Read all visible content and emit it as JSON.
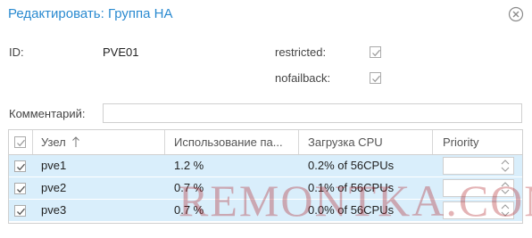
{
  "dialog": {
    "title": "Редактировать: Группа HA",
    "close_icon": "close-circle-icon"
  },
  "form": {
    "id_label": "ID:",
    "id_value": "PVE01",
    "restricted_label": "restricted:",
    "restricted_checked": false,
    "nofailback_label": "nofailback:",
    "nofailback_checked": false,
    "comment_label": "Комментарий:",
    "comment_value": "",
    "comment_placeholder": ""
  },
  "grid": {
    "columns": {
      "node": "Узел",
      "sort_icon": "arrow-up-icon",
      "usage": "Использование па...",
      "cpu": "Загрузка CPU",
      "priority": "Priority"
    },
    "rows": [
      {
        "checked": true,
        "node": "pve1",
        "usage": "1.2 %",
        "cpu": "0.2% of 56CPUs",
        "priority": ""
      },
      {
        "checked": true,
        "node": "pve2",
        "usage": "0.7 %",
        "cpu": "0.1% of 56CPUs",
        "priority": ""
      },
      {
        "checked": true,
        "node": "pve3",
        "usage": "0.7 %",
        "cpu": "0.0% of 56CPUs",
        "priority": ""
      }
    ]
  },
  "colors": {
    "title": "#2a8ad0",
    "row_selected": "#d9eefb",
    "border": "#d0d0d0"
  },
  "watermark": "REMONTKA.COM"
}
